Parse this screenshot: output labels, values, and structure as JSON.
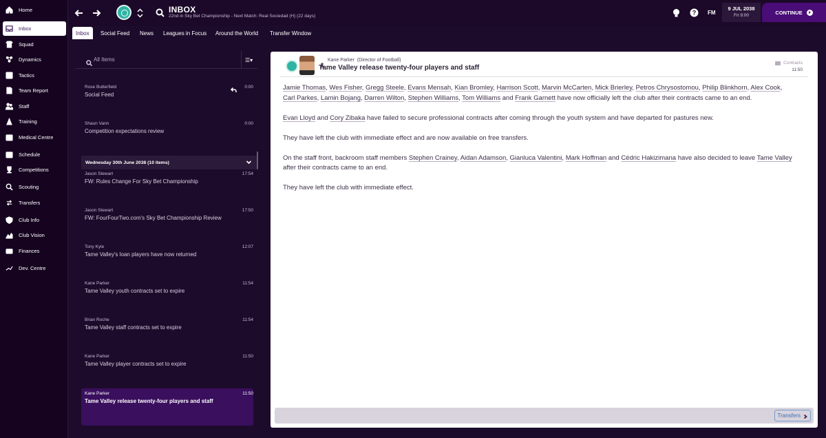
{
  "sidebar": {
    "items": [
      {
        "label": "Home",
        "icon": "home-icon"
      },
      {
        "label": "Inbox",
        "icon": "inbox-icon"
      },
      {
        "label": "Squad",
        "icon": "squad-icon"
      },
      {
        "label": "Dynamics",
        "icon": "dynamics-icon"
      },
      {
        "label": "Tactics",
        "icon": "tactics-icon"
      },
      {
        "label": "Team Report",
        "icon": "team-report-icon"
      },
      {
        "label": "Staff",
        "icon": "staff-icon"
      },
      {
        "label": "Training",
        "icon": "training-icon"
      },
      {
        "label": "Medical Centre",
        "icon": "medical-icon"
      },
      {
        "label": "Schedule",
        "icon": "calendar-icon"
      },
      {
        "label": "Competitions",
        "icon": "trophy-icon"
      },
      {
        "label": "Scouting",
        "icon": "scouting-icon"
      },
      {
        "label": "Transfers",
        "icon": "transfers-icon"
      },
      {
        "label": "Club Info",
        "icon": "shield-icon"
      },
      {
        "label": "Club Vision",
        "icon": "vision-icon"
      },
      {
        "label": "Finances",
        "icon": "finances-icon"
      },
      {
        "label": "Dev. Centre",
        "icon": "dev-centre-icon"
      }
    ],
    "active": "Inbox"
  },
  "header": {
    "title": "INBOX",
    "subtitle": "22nd in Sky Bet Championship - Next Match: Real Sociedad (H) (22 days)",
    "fm_label": "FM",
    "date": "9 JUL 2038",
    "day_time": "Fri 9:00",
    "continue_label": "CONTINUE"
  },
  "tabs": [
    {
      "label": "Inbox",
      "active": true
    },
    {
      "label": "Social Feed",
      "active": false
    },
    {
      "label": "News",
      "active": false
    },
    {
      "label": "Leagues in Focus",
      "active": false
    },
    {
      "label": "Around the World",
      "active": false
    },
    {
      "label": "Transfer Window",
      "active": false
    }
  ],
  "list": {
    "filter_placeholder": "All Items",
    "top_items": [
      {
        "sender": "Rose Butterfield",
        "subject": "Social Feed",
        "time": "0:00"
      },
      {
        "sender": "Shaun Vann",
        "subject": "Competition expectations review",
        "time": "0:00"
      }
    ],
    "group_header": "Wednesday 30th June 2038 (10 items)",
    "group_items": [
      {
        "sender": "Jason Stewart",
        "subject": "FW: Rules Change For Sky Bet Championship",
        "time": "17:54"
      },
      {
        "sender": "Jason Stewart",
        "subject": "FW: FourFourTwo.com's Sky Bet Championship Review",
        "time": "17:50"
      },
      {
        "sender": "Tony Kyle",
        "subject": "Tame Valley's loan players have now returned",
        "time": "12:07"
      },
      {
        "sender": "Kane Parker",
        "subject": "Tame Valley youth contracts set to expire",
        "time": "11:54"
      },
      {
        "sender": "Brian Roche",
        "subject": "Tame Valley staff contracts set to expire",
        "time": "11:54"
      },
      {
        "sender": "Kane Parker",
        "subject": "Tame Valley player contracts set to expire",
        "time": "11:50"
      },
      {
        "sender": "Kane Parker",
        "subject": "Tame Valley release twenty-four players and staff",
        "time": "11:50"
      }
    ]
  },
  "message": {
    "sender": "Kane Parker",
    "sender_role": "(Director of Football)",
    "subject": "Tame Valley release twenty-four players and staff",
    "tag": "Contracts",
    "time": "11:50",
    "p1_players": [
      "Jamie Thomas",
      "Wes Fisher",
      "Gregg Steele",
      "Evans Mensah",
      "Kian Bromley",
      "Harrison Scott",
      "Marvin McCarten",
      "Mick Brierley",
      "Petros Chrysostomou",
      "Philip Blinkhorn",
      "Alex Cook",
      "Carl Parkes",
      "Lamin Bojang",
      "Darren Wilton",
      "Stephen Williams",
      "Tom Williams"
    ],
    "p1_last": "Frank Garnett",
    "p1_tail": "have now officially left the club after their contracts came to an end.",
    "p2_a": "Evan Lloyd",
    "p2_b": "Cory Zibaka",
    "p2_tail": "have failed to secure professional contracts after coming through the youth system and have departed for pastures new.",
    "p3": "They have left the club with immediate effect and are now available on free transfers.",
    "p4_lead": "On the staff front, backroom staff members",
    "p4_staff": [
      "Stephen Crainey",
      "Aidan Adamson",
      "Gianluca Valentini",
      "Mark Hoffman"
    ],
    "p4_last": "Cédric Hakizimana",
    "p4_mid": "have also decided to leave",
    "p4_club": "Tame Valley",
    "p4_tail": "after their contracts came to an end.",
    "p5": "They have left the club with immediate effect.",
    "footer_button": "Transfers"
  }
}
